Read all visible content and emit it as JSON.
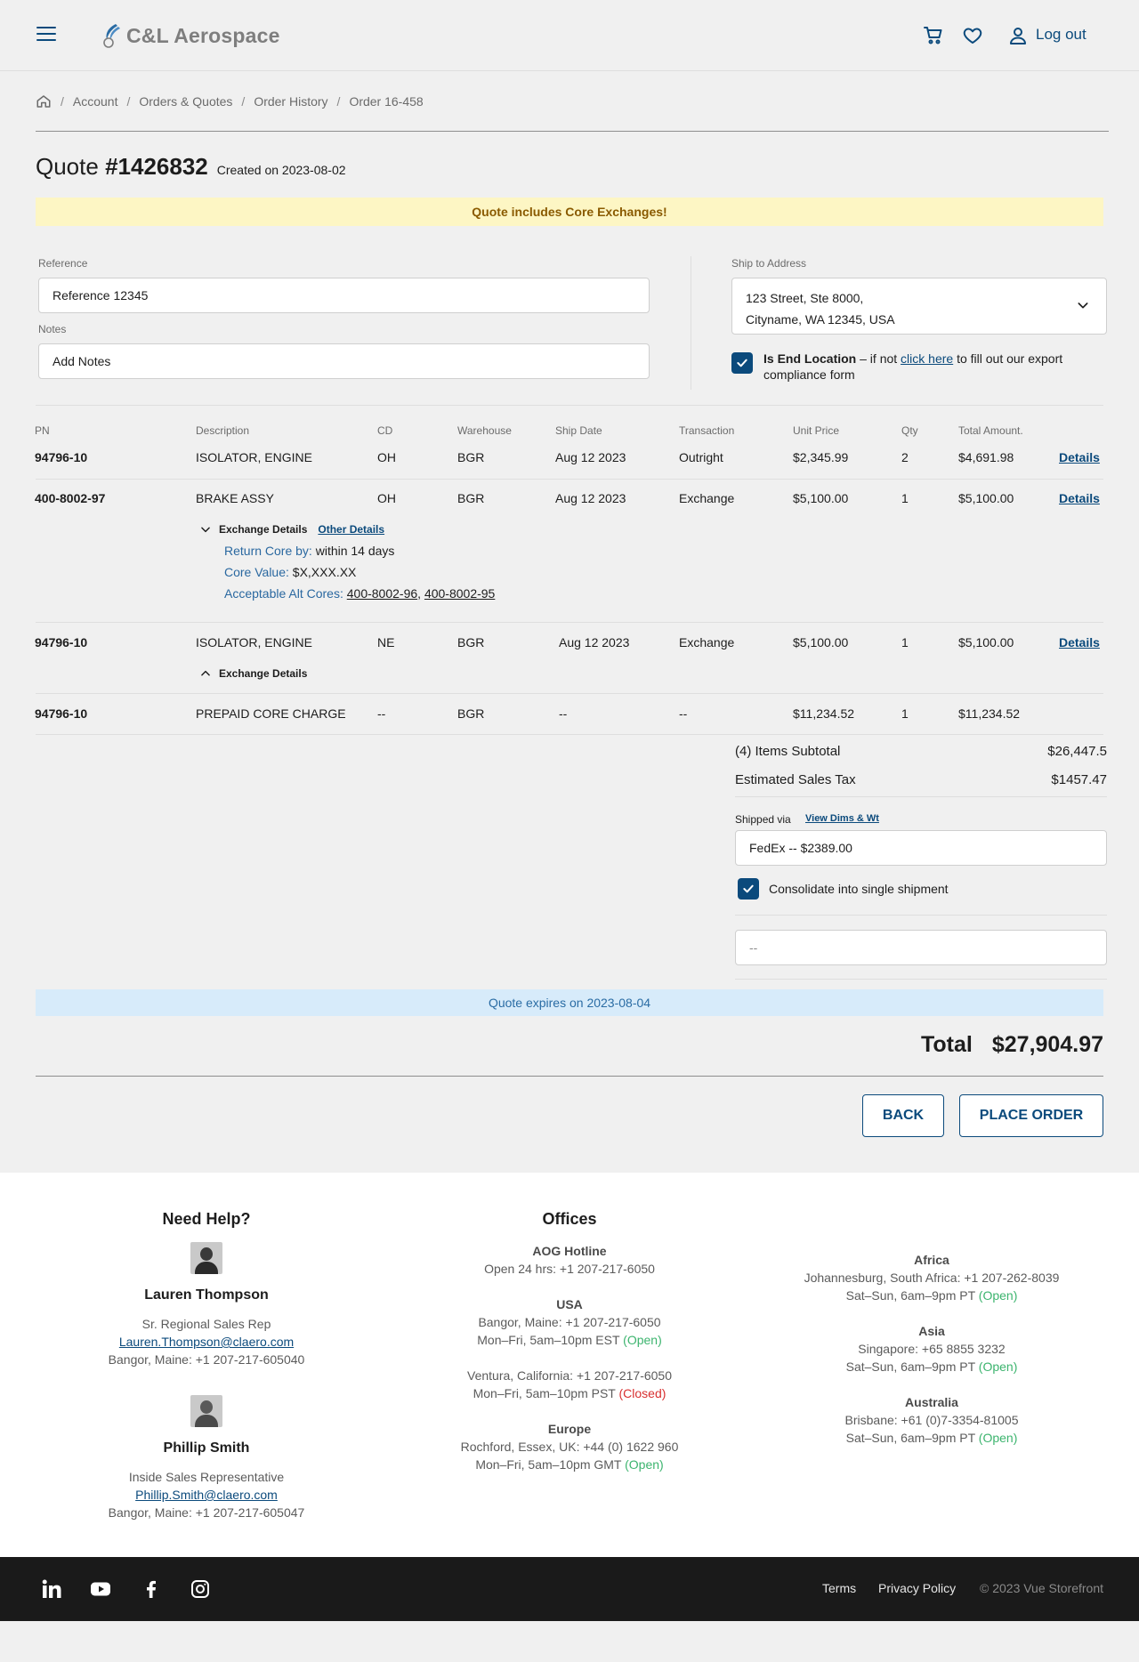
{
  "header": {
    "brand": "C&L Aerospace",
    "logout_label": "Log out"
  },
  "breadcrumb": [
    "Account",
    "Orders & Quotes",
    "Order History",
    "Order 16-458"
  ],
  "quote": {
    "title_prefix": "Quote",
    "number": "#1426832",
    "created": "Created on 2023-08-02",
    "core_banner": "Quote includes Core Exchanges!"
  },
  "form": {
    "reference_label": "Reference",
    "reference_value": "Reference 12345",
    "notes_label": "Notes",
    "notes_placeholder": "Add Notes",
    "ship_label": "Ship to Address",
    "ship_line1": "123 Street, Ste 8000,",
    "ship_line2": "Cityname, WA 12345, USA",
    "end_location_bold": "Is End Location",
    "end_location_text1": " – if not ",
    "end_location_link": "click here",
    "end_location_text2": " to fill out our export compliance form"
  },
  "table": {
    "headers": [
      "PN",
      "Description",
      "CD",
      "Warehouse",
      "Ship Date",
      "Transaction",
      "Unit Price",
      "Qty",
      "Total Amount."
    ],
    "rows": [
      {
        "pn": "94796-10",
        "desc": "ISOLATOR, ENGINE",
        "cd": "OH",
        "wh": "BGR",
        "ship": "Aug 12 2023",
        "trans": "Outright",
        "unit": "$2,345.99",
        "qty": "2",
        "total": "$4,691.98",
        "details": "Details"
      },
      {
        "pn": "400-8002-97",
        "desc": "BRAKE ASSY",
        "cd": "OH",
        "wh": "BGR",
        "ship": "Aug 12 2023",
        "trans": "Exchange",
        "unit": "$5,100.00",
        "qty": "1",
        "total": "$5,100.00",
        "details": "Details"
      },
      {
        "pn": "94796-10",
        "desc": "ISOLATOR, ENGINE",
        "cd": "NE",
        "wh": "BGR",
        "ship": "Aug 12 2023",
        "trans": "Exchange",
        "unit": "$5,100.00",
        "qty": "1",
        "total": "$5,100.00",
        "details": "Details"
      },
      {
        "pn": "94796-10",
        "desc": "PREPAID CORE CHARGE",
        "cd": "--",
        "wh": "BGR",
        "ship": "--",
        "trans": "--",
        "unit": "$11,234.52",
        "qty": "1",
        "total": "$11,234.52"
      }
    ],
    "exchange_details_label": "Exchange Details",
    "other_details_label": "Other Details",
    "return_core_key": "Return Core by:",
    "return_core_val": " within 14 days",
    "core_value_key": "Core Value:",
    "core_value_val": " $X,XXX.XX",
    "alt_cores_key": "Acceptable Alt Cores:",
    "alt_core_1": "400-8002-96",
    "alt_core_2": "400-8002-95"
  },
  "summary": {
    "subtotal_label": "(4) Items Subtotal",
    "subtotal_value": "$26,447.5",
    "tax_label": "Estimated Sales Tax",
    "tax_value": "$1457.47",
    "shipped_via_label": "Shipped via",
    "view_dims_label": "View Dims & Wt",
    "shipping_value": "FedEx -- $2389.00",
    "consolidate_label": "Consolidate into single shipment",
    "extra_field_value": "--",
    "expires": "Quote expires on 2023-08-04",
    "total_label": "Total",
    "total_value": "$27,904.97"
  },
  "actions": {
    "back": "BACK",
    "place_order": "PLACE ORDER"
  },
  "help": {
    "title": "Need Help?",
    "reps": [
      {
        "name": "Lauren Thompson",
        "role": "Sr. Regional Sales Rep",
        "email": "Lauren.Thompson@claero.com",
        "phone": "Bangor, Maine: +1 207-217-605040"
      },
      {
        "name": "Phillip Smith",
        "role": "Inside Sales Representative",
        "email": "Phillip.Smith@claero.com",
        "phone": "Bangor, Maine: +1 207-217-605047"
      }
    ]
  },
  "offices": {
    "title": "Offices",
    "aog_head": "AOG Hotline",
    "aog_line": "Open 24 hrs: +1 207-217-6050",
    "usa_head": "USA",
    "usa_1_line1": "Bangor, Maine: +1 207-217-6050",
    "usa_1_line2": "Mon–Fri, 5am–10pm EST ",
    "usa_1_status": "(Open)",
    "usa_2_line1": "Ventura, California: +1 207-217-6050",
    "usa_2_line2": "Mon–Fri, 5am–10pm PST ",
    "usa_2_status": "(Closed)",
    "europe_head": "Europe",
    "europe_line1": "Rochford, Essex, UK: +44 (0) 1622 960",
    "europe_line2": "Mon–Fri, 5am–10pm GMT ",
    "europe_status": "(Open)",
    "africa_head": "Africa",
    "africa_line1": "Johannesburg, South Africa: +1 207-262-8039",
    "africa_line2": "Sat–Sun, 6am–9pm PT ",
    "africa_status": "(Open)",
    "asia_head": "Asia",
    "asia_line1": "Singapore: +65 8855 3232",
    "asia_line2": "Sat–Sun, 6am–9pm PT ",
    "asia_status": "(Open)",
    "aus_head": "Australia",
    "aus_line1": "Brisbane: +61 (0)7-3354-81005",
    "aus_line2": "Sat–Sun, 6am–9pm PT ",
    "aus_status": "(Open)"
  },
  "footer": {
    "terms": "Terms",
    "privacy": "Privacy Policy",
    "copyright": "© 2023 Vue Storefront"
  },
  "colors": {
    "brand_blue": "#0b4a7c",
    "core_banner_bg": "#fdf6c4",
    "expires_banner_bg": "#d7ebfa",
    "open_green": "#3cb46e",
    "closed_red": "#d83030"
  },
  "icons": [
    "menu-icon",
    "logo-mark-icon",
    "cart-icon",
    "heart-icon",
    "user-icon",
    "home-icon",
    "chevron-down-icon",
    "chevron-up-icon",
    "check-icon",
    "linkedin-icon",
    "youtube-icon",
    "facebook-icon",
    "instagram-icon"
  ]
}
